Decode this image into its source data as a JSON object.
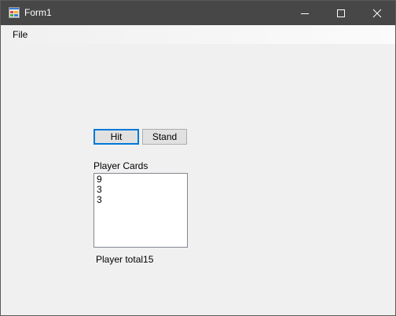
{
  "window": {
    "title": "Form1"
  },
  "menu": {
    "items": [
      {
        "label": "File"
      }
    ]
  },
  "buttons": {
    "hit": "Hit",
    "stand": "Stand"
  },
  "player": {
    "cards_label": "Player Cards",
    "cards": [
      "9",
      "3",
      "3"
    ],
    "total_label": "Player total",
    "total_value": "15"
  },
  "colors": {
    "titlebar": "#474747",
    "focus_border": "#0078d7",
    "window_bg": "#f0f0f0"
  }
}
